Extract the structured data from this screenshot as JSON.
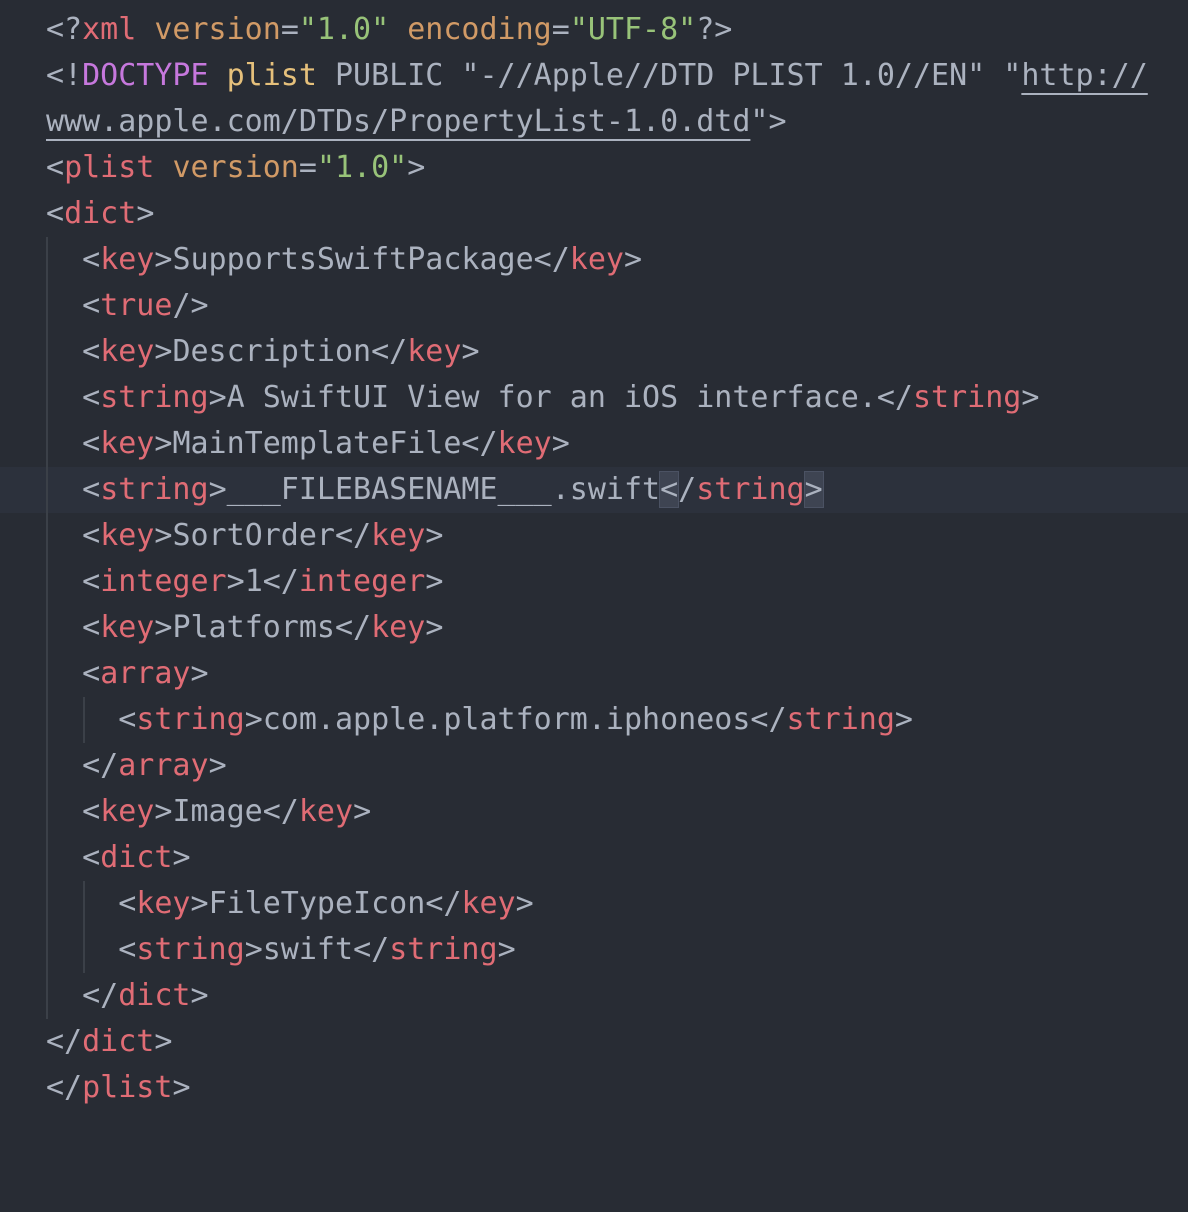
{
  "file": {
    "xml_decl": {
      "open": "<?",
      "name": "xml",
      "attr1": "version",
      "eq1": "=",
      "val1": "\"1.0\"",
      "attr2": "encoding",
      "eq2": "=",
      "val2": "\"UTF-8\"",
      "close": "?>"
    },
    "doctype": {
      "open": "<!",
      "keyword": "DOCTYPE",
      "root": "plist",
      "public_id": " PUBLIC \"-//Apple//DTD PLIST 1.0//EN\" \"",
      "url_part1": "http://",
      "url_part2": "www.apple.com/DTDs/PropertyList-1.0.dtd",
      "close": "\">"
    },
    "plist_open": {
      "lt": "<",
      "name": "plist",
      "attr": "version",
      "eq": "=",
      "val": "\"1.0\"",
      "gt": ">"
    },
    "entries": {
      "key1": "SupportsSwiftPackage",
      "key2": "Description",
      "string2": "A SwiftUI View for an iOS interface.",
      "key3": "MainTemplateFile",
      "string3": "___FILEBASENAME___.swift",
      "key4": "SortOrder",
      "integer4": "1",
      "key5": "Platforms",
      "platform1": "com.apple.platform.iphoneos",
      "key6": "Image",
      "key7": "FileTypeIcon",
      "string7": "swift"
    },
    "tags": {
      "dict": "dict",
      "key": "key",
      "true": "true",
      "string": "string",
      "integer": "integer",
      "array": "array",
      "plist": "plist"
    },
    "syntax": {
      "lt": "<",
      "gt": ">",
      "lt_slash": "</",
      "self_close": "/>"
    }
  },
  "colors": {
    "background": "#282c34",
    "active_line": "#2c313c",
    "tag": "#e06c75",
    "attribute": "#d19a66",
    "string": "#98c379",
    "keyword": "#c678dd",
    "doctype_root": "#e5c07b",
    "text": "#abb2bf"
  }
}
